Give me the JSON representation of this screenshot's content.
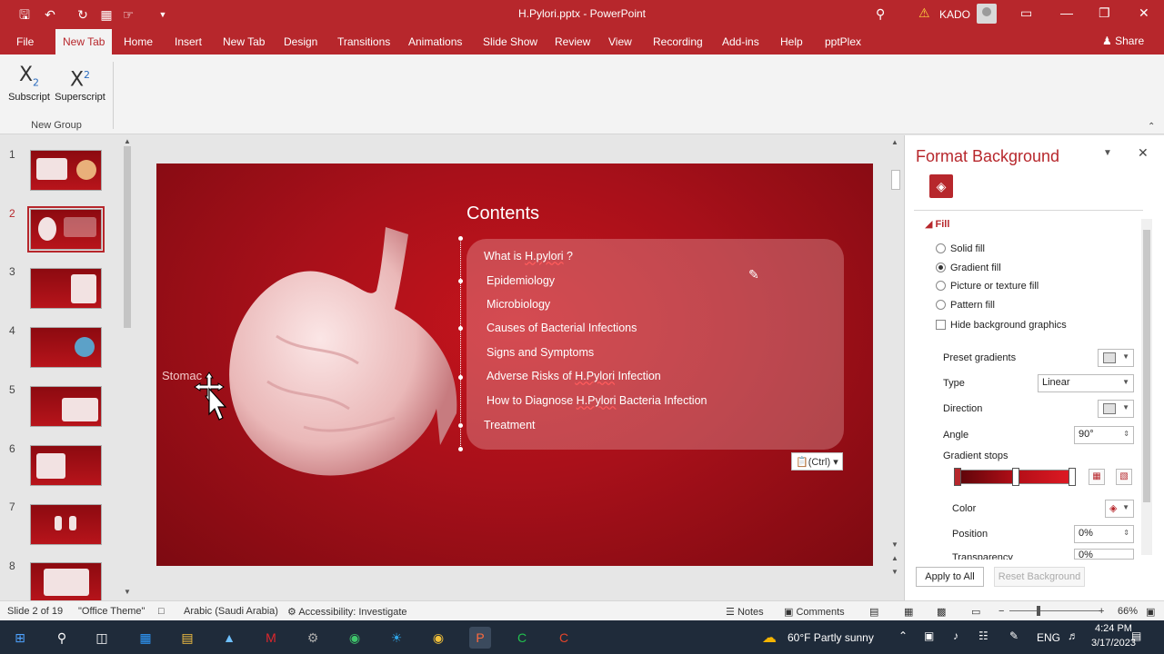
{
  "window": {
    "title": "H.Pylori.pptx - PowerPoint",
    "user": "KADO"
  },
  "tabs": [
    "File",
    "New Tab",
    "Home",
    "Insert",
    "New Tab",
    "Design",
    "Transitions",
    "Animations",
    "Slide Show",
    "Review",
    "View",
    "Recording",
    "Add-ins",
    "Help",
    "pptPlex"
  ],
  "share_label": "Share",
  "ribbon": {
    "subscript_label": "Subscript",
    "superscript_label": "Superscript",
    "group_label": "New Group"
  },
  "thumbnails": [
    "1",
    "2",
    "3",
    "4",
    "5",
    "6",
    "7",
    "8"
  ],
  "slide": {
    "title": "Contents",
    "items": [
      "What is ",
      "Epidemiology",
      "Microbiology",
      "Causes of Bacterial Infections",
      "Signs and Symptoms",
      "Adverse Risks of ",
      "How to Diagnose ",
      "Treatment"
    ],
    "item1_underlined": "H.pylori",
    "item1_suffix": " ?",
    "item6_underlined": "H.Pylori",
    "item6_suffix": " Infection",
    "item7_underlined": "H.Pylori",
    "item7_suffix": " Bacteria Infection",
    "stomach_label": "Stomac",
    "paste_ctrl": "(Ctrl)"
  },
  "pane": {
    "title": "Format Background",
    "fill_section": "Fill",
    "options": [
      "Solid fill",
      "Gradient fill",
      "Picture or texture fill",
      "Pattern fill"
    ],
    "selected_option": "Gradient fill",
    "hide_bg": "Hide background graphics",
    "preset_gradients": "Preset gradients",
    "type_label": "Type",
    "type_value": "Linear",
    "direction_label": "Direction",
    "angle_label": "Angle",
    "angle_value": "90°",
    "gradient_stops": "Gradient stops",
    "color_label": "Color",
    "position_label": "Position",
    "position_value": "0%",
    "transparency_label": "Transparency",
    "transparency_value": "0%",
    "apply_all": "Apply to All",
    "reset_bg": "Reset Background"
  },
  "status": {
    "slide_info": "Slide 2 of 19",
    "theme": "\"Office Theme\"",
    "language": "Arabic (Saudi Arabia)",
    "accessibility": "Accessibility: Investigate",
    "notes": "Notes",
    "comments": "Comments",
    "zoom": "66%"
  },
  "taskbar": {
    "weather": "60°F  Partly sunny",
    "lang": "ENG",
    "time": "4:24 PM",
    "date": "3/17/2023"
  },
  "colors": {
    "accent": "#b7272c",
    "slide_bg": "#a8101a"
  }
}
